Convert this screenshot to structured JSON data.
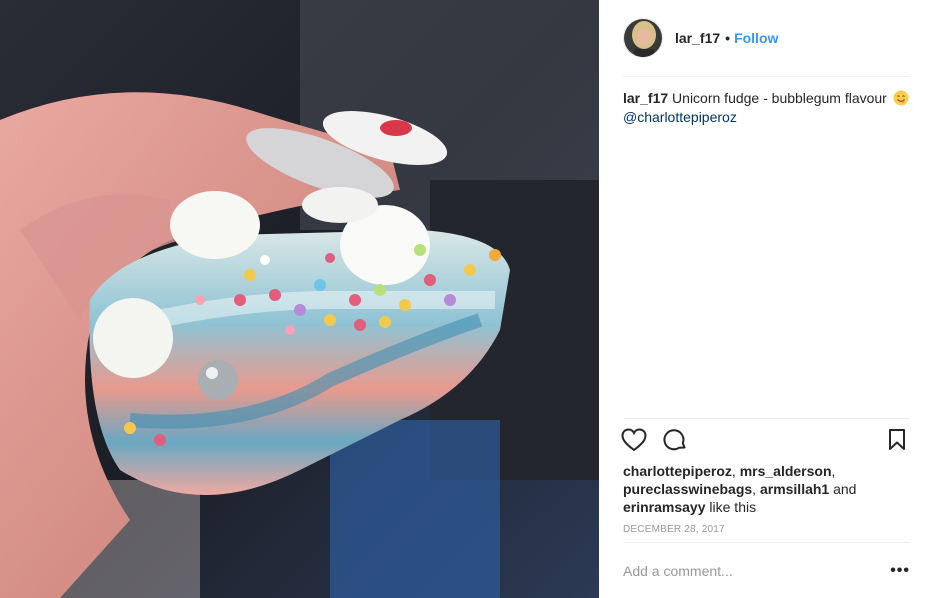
{
  "post": {
    "photo_icon": "post-photo-fudge",
    "author": {
      "username": "lar_f17",
      "separator": "•",
      "follow_label": "Follow",
      "avatar_icon": "avatar"
    },
    "caption": {
      "username": "lar_f17",
      "text": "Unicorn fudge - bubblegum flavour",
      "emoji_icon": "yum-face-emoji",
      "mention": "@charlottepiperoz"
    },
    "actions": {
      "like_icon": "heart-icon",
      "comment_icon": "comment-icon",
      "save_icon": "bookmark-icon"
    },
    "likes": {
      "users": [
        "charlottepiperoz",
        "mrs_alderson",
        "pureclasswinebags",
        "armsillah1",
        "erinramsayy"
      ],
      "sep1": ", ",
      "sep2": ", ",
      "sep3": ", ",
      "and_text": " and",
      "suffix": " like this"
    },
    "timestamp": "DECEMBER 28, 2017",
    "comment_box": {
      "placeholder": "Add a comment...",
      "more_label": "•••"
    },
    "colors": {
      "link_blue": "#3897f0",
      "mention_navy": "#003569",
      "text": "#262626",
      "muted": "#999999",
      "divider": "#efefef"
    }
  }
}
